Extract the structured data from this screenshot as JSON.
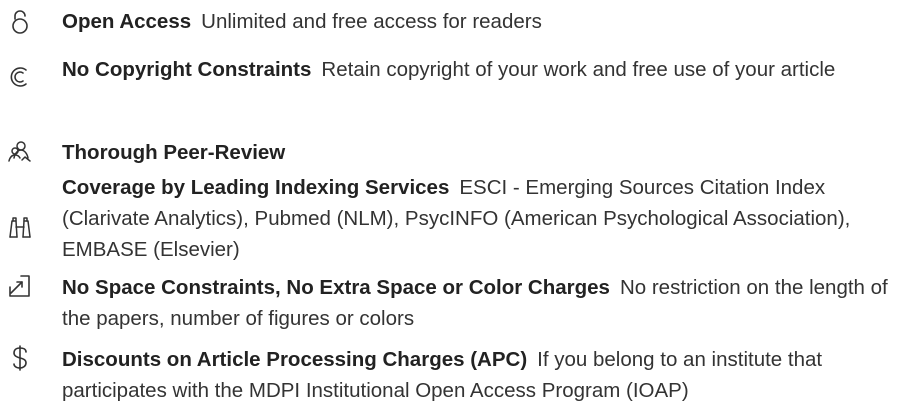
{
  "benefits": [
    {
      "icon": "lock-open-icon",
      "title": "Open Access",
      "description": "Unlimited and free access for readers"
    },
    {
      "icon": "copyright-icon",
      "title": "No Copyright Constraints",
      "description": "Retain copyright of your work and free use of your article"
    },
    {
      "icon": "peer-review-icon",
      "title": "Thorough Peer-Review",
      "description": ""
    },
    {
      "icon": "binoculars-icon",
      "title": "Coverage by Leading Indexing Services",
      "description": "ESCI - Emerging Sources Citation Index (Clarivate Analytics), Pubmed (NLM), PsycINFO (American Psychological Association), EMBASE (Elsevier)"
    },
    {
      "icon": "resize-icon",
      "title": "No Space Constraints, No Extra Space or Color Charges",
      "description": "No restriction on the length of the papers, number of figures or colors"
    },
    {
      "icon": "dollar-icon",
      "title": "Discounts on Article Processing Charges (APC)",
      "description": "If you belong to an institute that participates with the MDPI Institutional Open Access Program (IOAP)"
    }
  ]
}
